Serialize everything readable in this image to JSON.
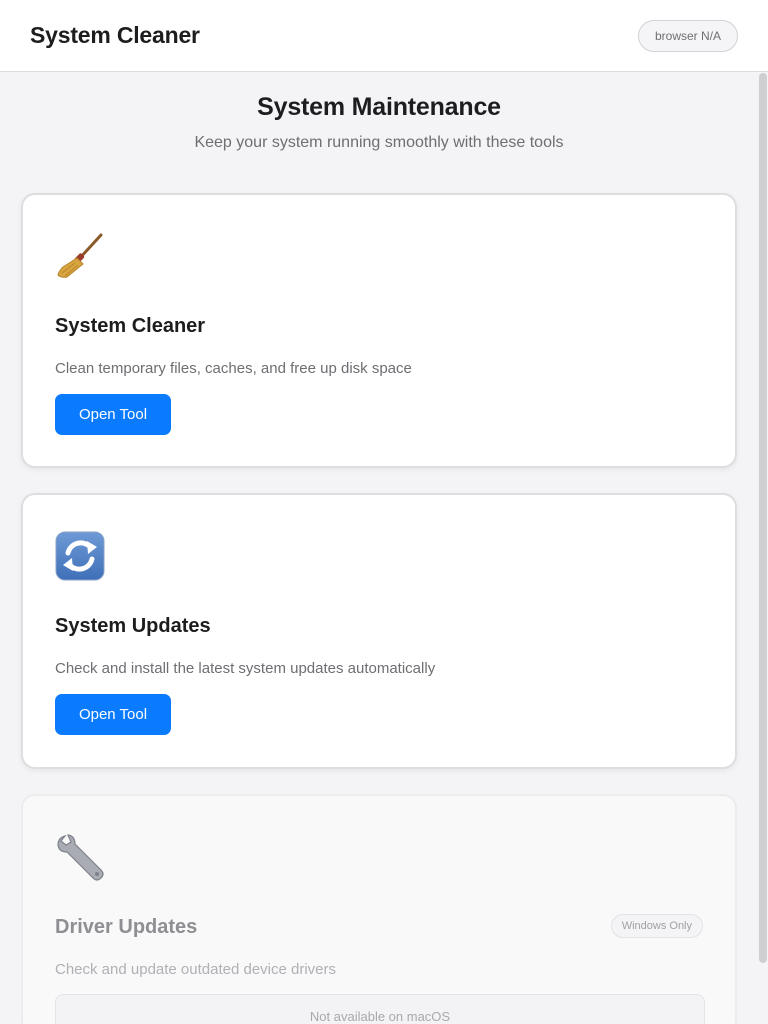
{
  "header": {
    "app_title": "System Cleaner",
    "browser_badge": "browser N/A"
  },
  "main": {
    "title": "System Maintenance",
    "subtitle": "Keep your system running smoothly with these tools"
  },
  "tools": [
    {
      "icon": "broom-icon",
      "title": "System Cleaner",
      "description": "Clean temporary files, caches, and free up disk space",
      "button": "Open Tool",
      "enabled": true
    },
    {
      "icon": "refresh-arrows-icon",
      "title": "System Updates",
      "description": "Check and install the latest system updates automatically",
      "button": "Open Tool",
      "enabled": true
    },
    {
      "icon": "wrench-icon",
      "title": "Driver Updates",
      "description": "Check and update outdated device drivers",
      "badge": "Windows Only",
      "unavailable_text": "Not available on macOS",
      "enabled": false
    }
  ],
  "colors": {
    "accent": "#0a7aff",
    "background": "#f4f4f6",
    "card": "#ffffff"
  }
}
